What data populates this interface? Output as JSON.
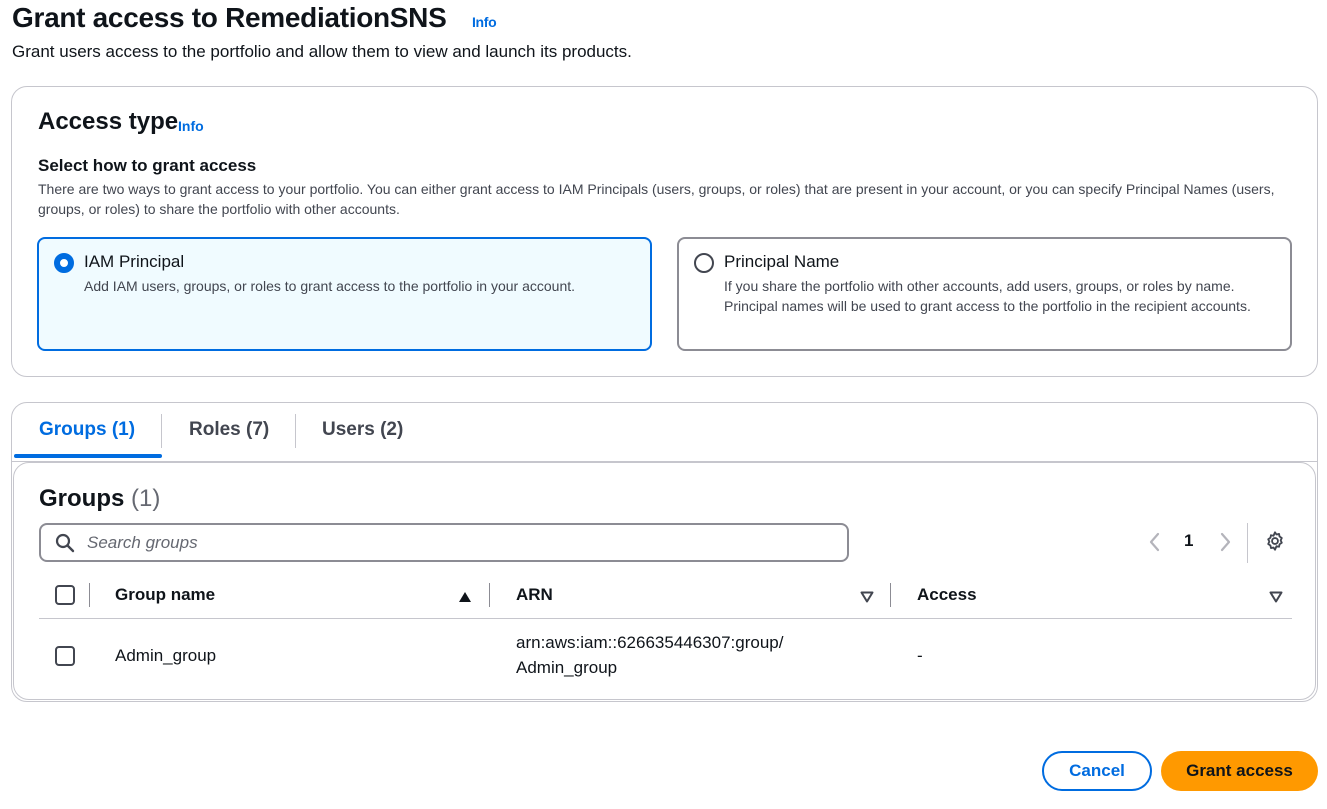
{
  "header": {
    "title": "Grant access to RemediationSNS",
    "info_label": "Info",
    "description": "Grant users access to the portfolio and allow them to view and launch its products."
  },
  "access_type": {
    "title": "Access type",
    "info_label": "Info",
    "select_label": "Select how to grant access",
    "select_description": "There are two ways to grant access to your portfolio. You can either grant access to IAM Principals (users, groups, or roles) that are present in your account, or you can specify Principal Names (users, groups, or roles) to share the portfolio with other accounts.",
    "options": [
      {
        "label": "IAM Principal",
        "description": "Add IAM users, groups, or roles to grant access to the portfolio in your account.",
        "selected": true
      },
      {
        "label": "Principal Name",
        "description": "If you share the portfolio with other accounts, add users, groups, or roles by name. Principal names will be used to grant access to the portfolio in the recipient accounts.",
        "selected": false
      }
    ]
  },
  "tabs": [
    {
      "label": "Groups (1)",
      "active": true
    },
    {
      "label": "Roles (7)",
      "active": false
    },
    {
      "label": "Users (2)",
      "active": false
    }
  ],
  "groups_table": {
    "title": "Groups",
    "count": "(1)",
    "search_placeholder": "Search groups",
    "search_value": "",
    "page_number": "1",
    "columns": [
      "Group name",
      "ARN",
      "Access"
    ],
    "rows": [
      {
        "group_name": "Admin_group",
        "arn_line1": "arn:aws:iam::626635446307:group/",
        "arn_line2": "Admin_group",
        "access": "-"
      }
    ]
  },
  "footer": {
    "cancel_label": "Cancel",
    "grant_label": "Grant access"
  },
  "colors": {
    "accent": "#006ce0",
    "primary_button": "#ff9900",
    "selected_tile_bg": "#f0fbff"
  }
}
